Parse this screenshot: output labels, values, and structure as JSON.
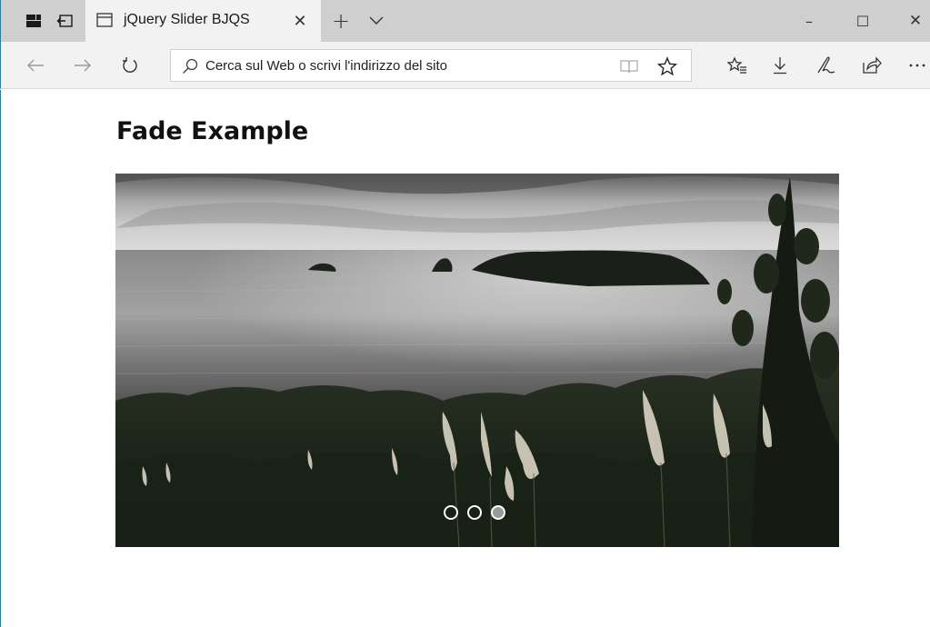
{
  "browser": {
    "tab": {
      "title": "jQuery Slider BJQS",
      "favicon": "page-icon",
      "close_glyph": "✕"
    },
    "new_tab_glyph": "+",
    "address": {
      "placeholder": "Cerca sul Web o scrivi l'indirizzo del sito",
      "value": ""
    },
    "icons": {
      "set_aside": "tabs-aside-icon",
      "restore": "restore-tabs-icon",
      "back": "back-arrow-icon",
      "forward": "forward-arrow-icon",
      "refresh": "refresh-icon",
      "reading_view": "reading-view-icon",
      "favorite": "star-icon",
      "favorites_hub": "favorites-hub-icon",
      "downloads": "download-icon",
      "notes": "pen-icon",
      "share": "share-icon",
      "more": "more-icon"
    },
    "window_controls": {
      "minimize": "–",
      "maximize": "☐",
      "close": "✕"
    }
  },
  "page": {
    "title": "Fade Example",
    "slider": {
      "image": "coastal-landscape-photo",
      "slide_count": 3,
      "active_index": 2
    }
  },
  "colors": {
    "tabbar_bg": "#cfcfcf",
    "toolbar_bg": "#f2f2f2",
    "accent_edge": "#2d7d9a",
    "marker_active": "#9a9a9a"
  }
}
